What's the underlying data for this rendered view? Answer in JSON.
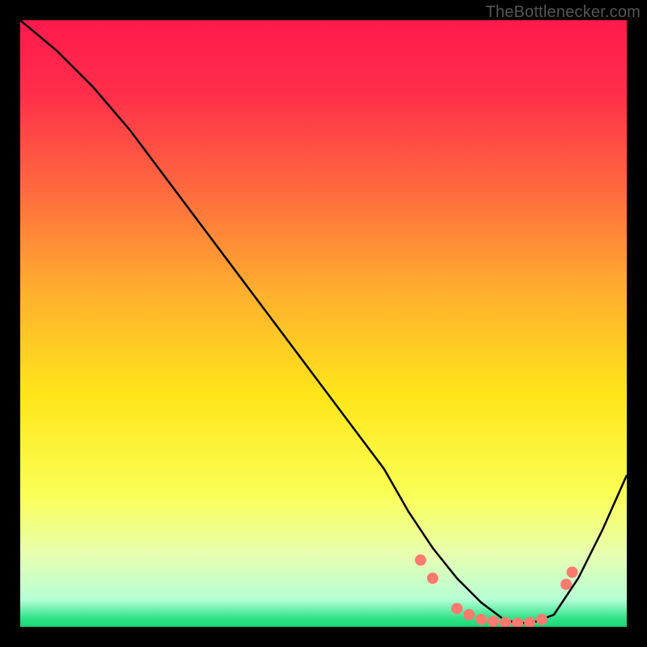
{
  "attribution": "TheBottlenecker.com",
  "chart_data": {
    "type": "line",
    "title": "",
    "xlabel": "",
    "ylabel": "",
    "xlim": [
      0,
      100
    ],
    "ylim": [
      0,
      100
    ],
    "grid": false,
    "background_gradient": {
      "stops": [
        {
          "offset": 0.0,
          "color": "#ff1a4d"
        },
        {
          "offset": 0.12,
          "color": "#ff2e4a"
        },
        {
          "offset": 0.28,
          "color": "#ff6a3f"
        },
        {
          "offset": 0.45,
          "color": "#ffb02e"
        },
        {
          "offset": 0.62,
          "color": "#ffe61a"
        },
        {
          "offset": 0.78,
          "color": "#faff55"
        },
        {
          "offset": 0.88,
          "color": "#e8ffb0"
        },
        {
          "offset": 0.955,
          "color": "#b6ffd6"
        },
        {
          "offset": 0.985,
          "color": "#33e38a"
        },
        {
          "offset": 1.0,
          "color": "#17d873"
        }
      ]
    },
    "series": [
      {
        "name": "bottleneck-curve",
        "color": "#000000",
        "x": [
          0,
          6,
          12,
          18,
          24,
          30,
          36,
          42,
          48,
          54,
          60,
          64,
          68,
          72,
          76,
          80,
          84,
          88,
          92,
          96,
          100
        ],
        "y": [
          100,
          95,
          89,
          82,
          74,
          66,
          58,
          50,
          42,
          34,
          26,
          19,
          13,
          8,
          4,
          1,
          0.5,
          2,
          8,
          16,
          25
        ]
      }
    ],
    "markers": {
      "name": "highlight-points",
      "color": "#ff7a6e",
      "radius": 7,
      "points": [
        {
          "x": 66,
          "y": 11
        },
        {
          "x": 68,
          "y": 8
        },
        {
          "x": 72,
          "y": 3
        },
        {
          "x": 74,
          "y": 2
        },
        {
          "x": 76,
          "y": 1.2
        },
        {
          "x": 78,
          "y": 0.9
        },
        {
          "x": 80,
          "y": 0.7
        },
        {
          "x": 82,
          "y": 0.6
        },
        {
          "x": 84,
          "y": 0.7
        },
        {
          "x": 86,
          "y": 1.2
        },
        {
          "x": 90,
          "y": 7
        },
        {
          "x": 91,
          "y": 9
        }
      ]
    }
  }
}
